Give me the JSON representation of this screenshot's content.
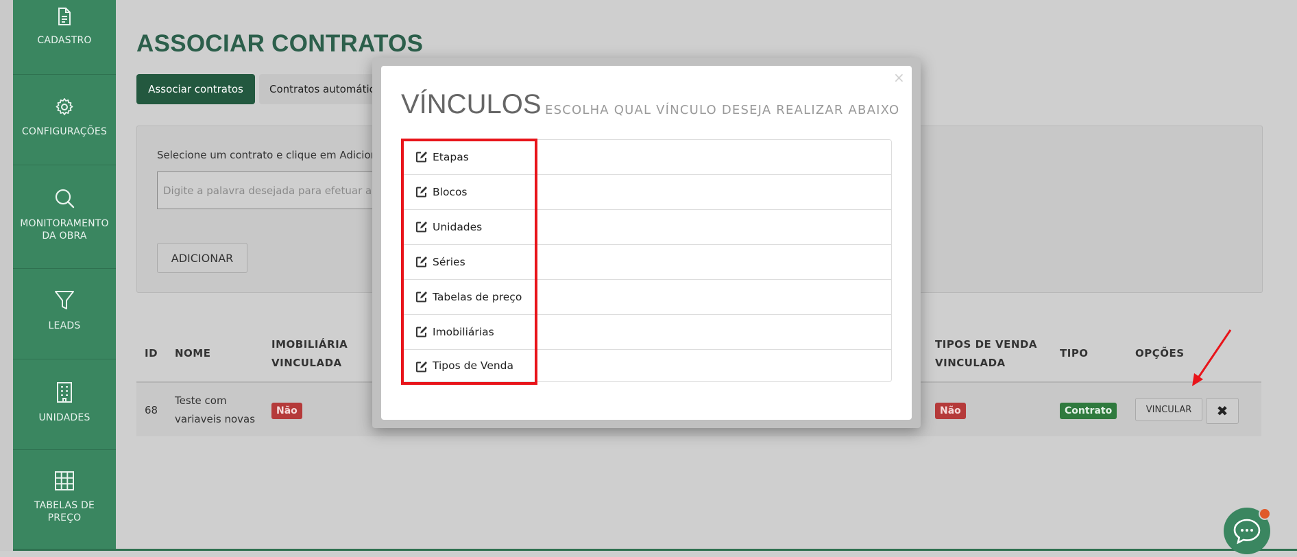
{
  "sidebar": {
    "items": [
      {
        "label": "CADASTRO",
        "icon": "document-icon"
      },
      {
        "label": "CONFIGURAÇÕES",
        "icon": "gear-icon"
      },
      {
        "label": "MONITORAMENTO\nDA OBRA",
        "icon": "search-icon"
      },
      {
        "label": "LEADS",
        "icon": "funnel-icon"
      },
      {
        "label": "UNIDADES",
        "icon": "building-icon"
      },
      {
        "label": "TABELAS DE\nPREÇO",
        "icon": "grid-icon"
      }
    ]
  },
  "page": {
    "title": "ASSOCIAR CONTRATOS",
    "tabs": [
      "Associar contratos",
      "Contratos automático"
    ]
  },
  "panel": {
    "instruction": "Selecione um contrato e clique em Adiciona",
    "search_placeholder": "Digite a palavra desejada para efetuar a b",
    "add_button": "ADICIONAR"
  },
  "table": {
    "headers": {
      "id": "ID",
      "nome": "NOME",
      "imobiliaria": "IMOBILIÁRIA\nVINCULADA",
      "tipos_venda": "TIPOS DE VENDA\nVINCULADA",
      "tipo": "TIPO",
      "opcoes": "OPÇÕES"
    },
    "rows": [
      {
        "id": "68",
        "nome": "Teste com\nvariaveis novas",
        "imobiliaria": "Não",
        "tipos_venda": "Não",
        "tipo": "Contrato",
        "vincular": "VINCULAR",
        "delete": "✖"
      }
    ]
  },
  "modal": {
    "title": "VÍNCULOS",
    "subtitle": "ESCOLHA QUAL VÍNCULO DESEJA REALIZAR ABAIXO",
    "close": "×",
    "items": [
      "Etapas",
      "Blocos",
      "Unidades",
      "Séries",
      "Tabelas de preço",
      "Imobiliárias",
      "Tipos de Venda"
    ]
  },
  "colors": {
    "sidebar": "#3a8660",
    "title": "#2c5f4b",
    "highlight": "#e8141a",
    "badge_red": "#b53a3a",
    "badge_green": "#2f7a3e"
  }
}
